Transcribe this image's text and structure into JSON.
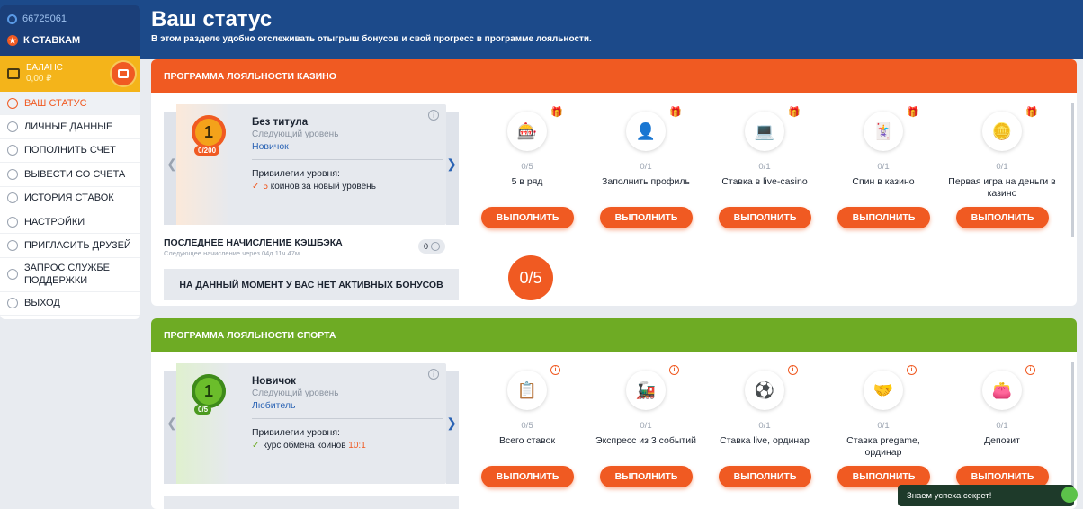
{
  "sidebar": {
    "account_id": "66725061",
    "to_bets_label": "К СТАВКАМ",
    "balance_label": "БАЛАНС",
    "balance_value": "0,00 ₽",
    "menu": [
      {
        "label": "ВАШ СТАТУС",
        "icon": "status-icon",
        "active": true
      },
      {
        "label": "ЛИЧНЫЕ ДАННЫЕ",
        "icon": "user-icon"
      },
      {
        "label": "ПОПОЛНИТЬ СЧЕТ",
        "icon": "deposit-icon"
      },
      {
        "label": "ВЫВЕСТИ СО СЧЕТА",
        "icon": "withdraw-icon"
      },
      {
        "label": "ИСТОРИЯ СТАВОК",
        "icon": "history-icon"
      },
      {
        "label": "НАСТРОЙКИ",
        "icon": "gear-icon"
      },
      {
        "label": "ПРИГЛАСИТЬ ДРУЗЕЙ",
        "icon": "heart-icon"
      },
      {
        "label": "ЗАПРОС СЛУЖБЕ ПОДДЕРЖКИ",
        "icon": "chat-icon"
      },
      {
        "label": "ВЫХОД",
        "icon": "logout-icon"
      }
    ]
  },
  "header": {
    "title": "Ваш статус",
    "description": "В этом разделе удобно отслеживать отыгрыш бонусов и свой прогресс в программе лояльности."
  },
  "casino": {
    "title": "ПРОГРАММА ЛОЯЛЬНОСТИ КАЗИНО",
    "level": {
      "medal_number": "1",
      "progress": "0/200",
      "name": "Без титула",
      "next_label": "Следующий уровень",
      "next_level": "Новичок",
      "privileges_label": "Привилегии уровня:",
      "privilege_number": "5",
      "privilege_text": " коинов за новый уровень"
    },
    "cashback_title": "ПОСЛЕДНЕЕ НАЧИСЛЕНИЕ КЭШБЭКА",
    "cashback_sub": "Следующее начисление через 04д 11ч 47м",
    "cashback_value": "0",
    "no_bonus": "НА ДАННЫЙ МОМЕНТ У ВАС НЕТ АКТИВНЫХ БОНУСОВ",
    "counter": "0/5",
    "tasks": [
      {
        "progress": "0/5",
        "name": "5 в ряд",
        "button": "ВЫПОЛНИТЬ",
        "icon": "slot-machine-icon"
      },
      {
        "progress": "0/1",
        "name": "Заполнить профиль",
        "button": "ВЫПОЛНИТЬ",
        "icon": "profile-icon"
      },
      {
        "progress": "0/1",
        "name": "Ставка в live-casino",
        "button": "ВЫПОЛНИТЬ",
        "icon": "live-casino-icon"
      },
      {
        "progress": "0/1",
        "name": "Спин в казино",
        "button": "ВЫПОЛНИТЬ",
        "icon": "cards-icon"
      },
      {
        "progress": "0/1",
        "name": "Первая игра на деньги в казино",
        "button": "ВЫПОЛНИТЬ",
        "icon": "coins-icon"
      }
    ]
  },
  "sport": {
    "title": "ПРОГРАММА ЛОЯЛЬНОСТИ СПОРТА",
    "level": {
      "medal_number": "1",
      "progress": "0/5",
      "name": "Новичок",
      "next_label": "Следующий уровень",
      "next_level": "Любитель",
      "privileges_label": "Привилегии уровня:",
      "privilege_text": "курс обмена коинов ",
      "privilege_number": "10:1"
    },
    "tasks": [
      {
        "progress": "0/5",
        "name": "Всего ставок",
        "button": "ВЫПОЛНИТЬ",
        "icon": "bet-slip-icon"
      },
      {
        "progress": "0/1",
        "name": "Экспресс из 3 событий",
        "button": "ВЫПОЛНИТЬ",
        "icon": "express-icon"
      },
      {
        "progress": "0/1",
        "name": "Ставка live, ординар",
        "button": "ВЫПОЛНИТЬ",
        "icon": "live-tv-icon"
      },
      {
        "progress": "0/1",
        "name": "Ставка pregame, ординар",
        "button": "ВЫПОЛНИТЬ",
        "icon": "handshake-icon"
      },
      {
        "progress": "0/1",
        "name": "Депозит",
        "button": "ВЫПОЛНИТЬ",
        "icon": "wallet-icon"
      }
    ]
  },
  "toast": "Знаем успеха секрет!",
  "colors": {
    "accent": "#f05a22",
    "sport": "#6eab24",
    "brand": "#1c4a8a",
    "balance": "#f4b41a"
  }
}
